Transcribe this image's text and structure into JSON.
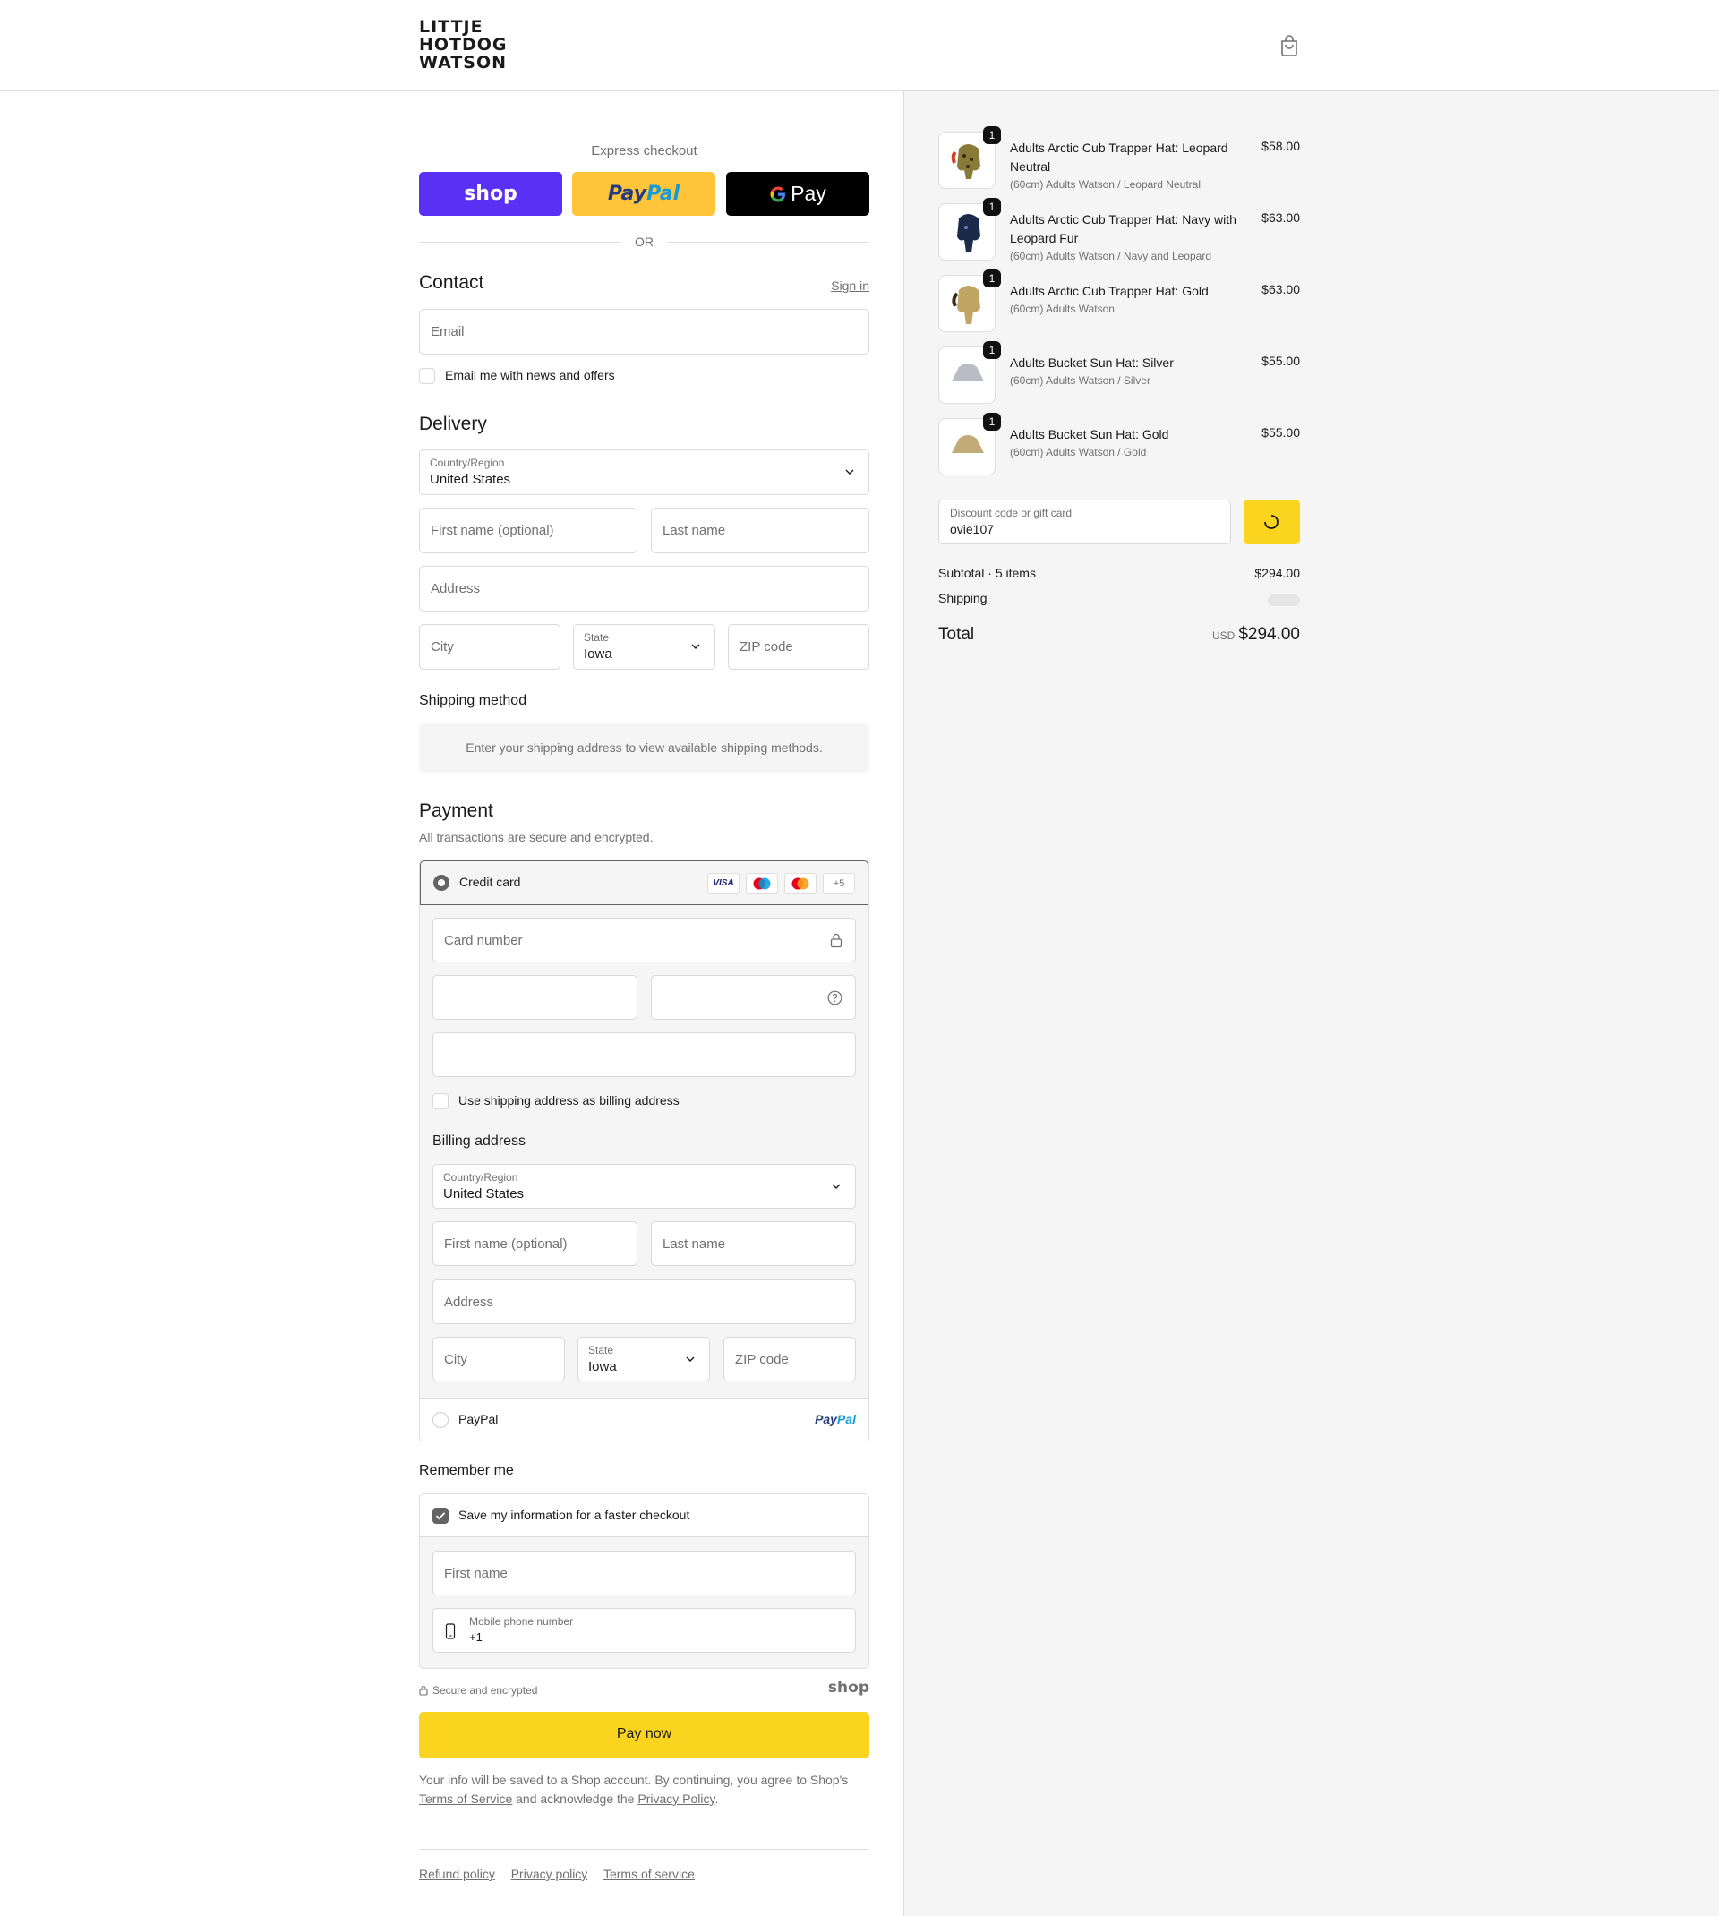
{
  "header": {
    "logo_lines": [
      "LITTJE",
      "HOTDOG",
      "WATSON"
    ],
    "cart_icon": "shopping-bag-icon"
  },
  "express": {
    "title": "Express checkout",
    "shop_label": "shop",
    "paypal_label_a": "Pay",
    "paypal_label_b": "Pal",
    "gpay_label": "Pay",
    "or_label": "OR"
  },
  "contact": {
    "heading": "Contact",
    "sign_in": "Sign in",
    "email_placeholder": "Email",
    "news_label": "Email me with news and offers"
  },
  "delivery": {
    "heading": "Delivery",
    "country_label": "Country/Region",
    "country_value": "United States",
    "first_name_ph": "First name (optional)",
    "last_name_ph": "Last name",
    "address_ph": "Address",
    "city_ph": "City",
    "state_label": "State",
    "state_value": "Iowa",
    "zip_ph": "ZIP code"
  },
  "shipping": {
    "heading": "Shipping method",
    "message": "Enter your shipping address to view available shipping methods."
  },
  "payment": {
    "heading": "Payment",
    "subtitle": "All transactions are secure and encrypted.",
    "credit_card_label": "Credit card",
    "card_logos": [
      "VISA",
      "maestro",
      "mastercard",
      "+5"
    ],
    "card_number_ph": "Card number",
    "use_shipping_label": "Use shipping address as billing address",
    "billing_heading": "Billing address",
    "billing_country_label": "Country/Region",
    "billing_country_value": "United States",
    "billing_first_ph": "First name (optional)",
    "billing_last_ph": "Last name",
    "billing_address_ph": "Address",
    "billing_city_ph": "City",
    "billing_state_label": "State",
    "billing_state_value": "Iowa",
    "billing_zip_ph": "ZIP code",
    "paypal_label": "PayPal",
    "paypal_logo_a": "Pay",
    "paypal_logo_b": "Pal"
  },
  "remember": {
    "heading": "Remember me",
    "save_label": "Save my information for a faster checkout",
    "first_name_ph": "First name",
    "phone_label": "Mobile phone number",
    "phone_value": "+1",
    "secure_label": "Secure and encrypted",
    "shop_logo": "shop"
  },
  "pay_now": "Pay now",
  "legal": {
    "text_a": "Your info will be saved to a Shop account. By continuing, you agree to Shop's",
    "terms": "Terms of Service",
    "text_b": " and acknowledge the ",
    "privacy": "Privacy Policy",
    "text_c": "."
  },
  "footer": {
    "refund": "Refund policy",
    "privacy": "Privacy policy",
    "terms": "Terms of service"
  },
  "cart": {
    "items": [
      {
        "name": "Adults Arctic Cub Trapper Hat: Leopard Neutral",
        "variant": "(60cm) Adults Watson / Leopard Neutral",
        "price": "$58.00",
        "qty": "1",
        "color": "#8a7a3a"
      },
      {
        "name": "Adults Arctic Cub Trapper Hat: Navy with Leopard Fur",
        "variant": "(60cm) Adults Watson / Navy and Leopard",
        "price": "$63.00",
        "qty": "1",
        "color": "#1c2a4a"
      },
      {
        "name": "Adults Arctic Cub Trapper Hat: Gold",
        "variant": "(60cm) Adults Watson",
        "price": "$63.00",
        "qty": "1",
        "color": "#c0a565"
      },
      {
        "name": "Adults Bucket Sun Hat: Silver",
        "variant": "(60cm) Adults Watson / Silver",
        "price": "$55.00",
        "qty": "1",
        "color": "#b9bcc4"
      },
      {
        "name": "Adults Bucket Sun Hat: Gold",
        "variant": "(60cm) Adults Watson / Gold",
        "price": "$55.00",
        "qty": "1",
        "color": "#c2ab78"
      }
    ],
    "discount_label": "Discount code or gift card",
    "discount_value": "ovie107",
    "subtotal_label": "Subtotal · 5 items",
    "subtotal_value": "$294.00",
    "shipping_label": "Shipping",
    "total_label": "Total",
    "currency": "USD",
    "total_value": "$294.00"
  },
  "colors": {
    "shop_purple": "#5a31f4",
    "paypal_yellow": "#ffc439",
    "accent_yellow": "#fad41e"
  }
}
